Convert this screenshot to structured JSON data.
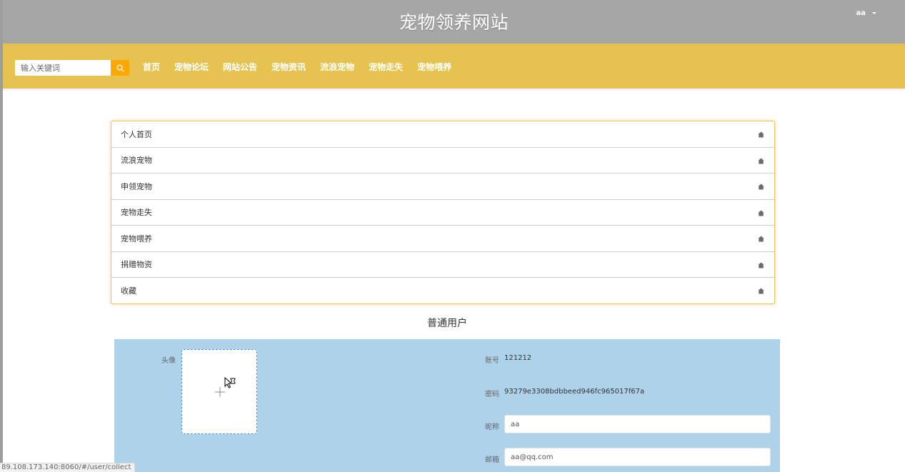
{
  "header": {
    "site_title": "宠物领养网站",
    "username": "aa"
  },
  "nav": {
    "search_placeholder": "输入关键词",
    "links": [
      "首页",
      "宠物论坛",
      "网站公告",
      "宠物资讯",
      "流浪宠物",
      "宠物走失",
      "宠物喂养"
    ]
  },
  "menu": {
    "items": [
      "个人首页",
      "流浪宠物",
      "申领宠物",
      "宠物走失",
      "宠物喂养",
      "捐赠物资",
      "收藏"
    ]
  },
  "profile": {
    "user_type": "普通用户",
    "avatar_label": "头像",
    "account_label": "账号",
    "account_value": "121212",
    "password_label": "密码",
    "password_value": "93279e3308bdbbeed946fc965017f67a",
    "nickname_label": "昵称",
    "nickname_value": "aa",
    "email_label": "邮箱",
    "email_value": "aa@qq.com"
  },
  "status_bar": {
    "url": "89.108.173.140:8060/#/user/collect"
  },
  "colors": {
    "topbar": "#a6a6a7",
    "navbar": "#e6c350",
    "search_button": "#ffa800",
    "panel": "#aed2ea",
    "menu_border": "#f2c25a"
  },
  "icons": {
    "search": "search-icon",
    "menu_item": "home-icon",
    "avatar_upload": "plus-icon",
    "user_menu": "caret-down-icon"
  }
}
